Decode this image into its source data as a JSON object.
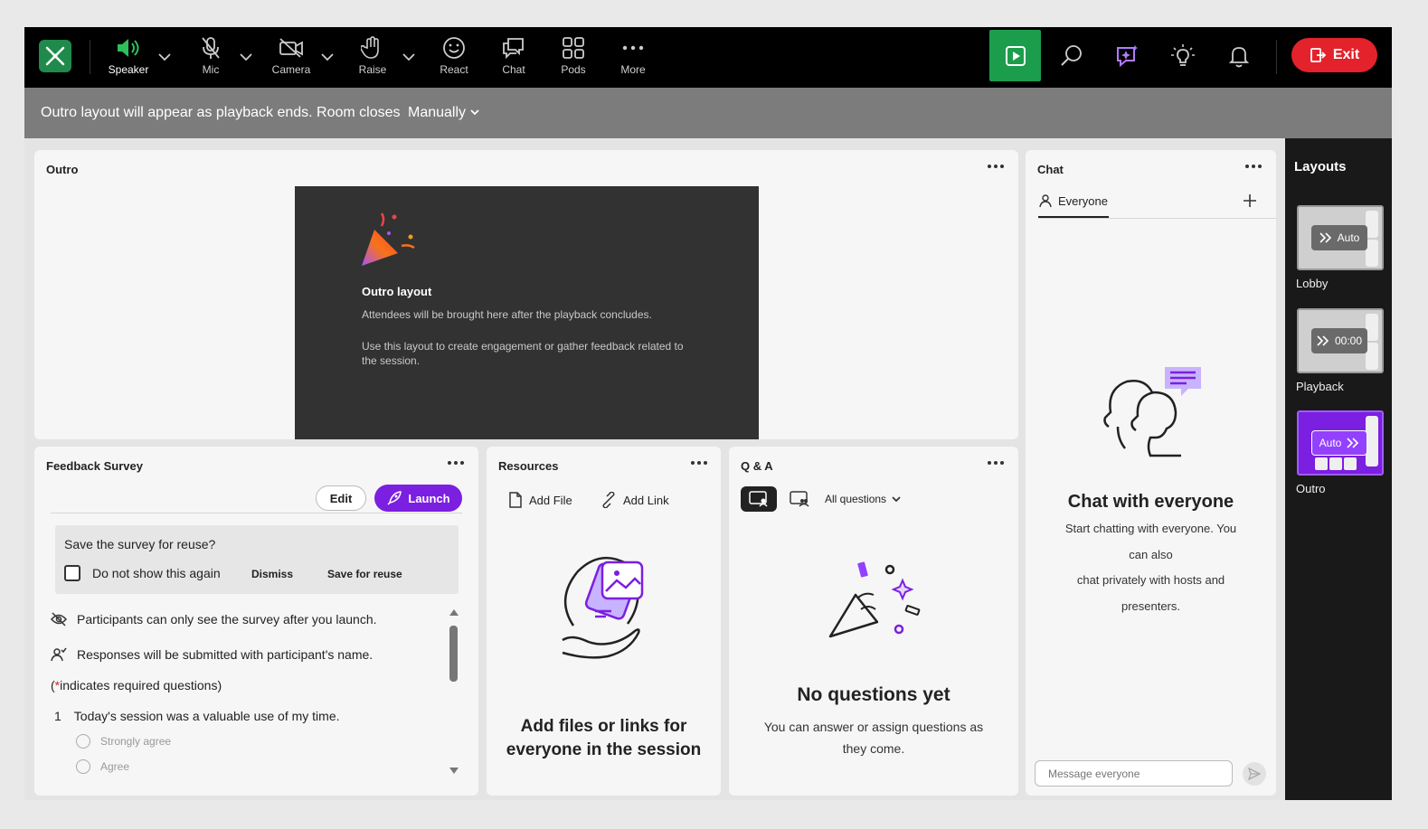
{
  "toolbar": {
    "items": [
      {
        "label": "Speaker",
        "icon": "speaker-icon"
      },
      {
        "label": "Mic",
        "icon": "mic-off-icon"
      },
      {
        "label": "Camera",
        "icon": "camera-off-icon"
      },
      {
        "label": "Raise",
        "icon": "hand-icon"
      },
      {
        "label": "React",
        "icon": "smiley-icon"
      },
      {
        "label": "Chat",
        "icon": "chat-icon"
      },
      {
        "label": "Pods",
        "icon": "pods-grid-icon"
      },
      {
        "label": "More",
        "icon": "more-dots-icon"
      }
    ],
    "exit_label": "Exit",
    "accent": "#1c9d4b",
    "exit_color": "#e3222b"
  },
  "banner": {
    "text": "Outro layout will appear as playback ends. Room closes",
    "mode": "Manually"
  },
  "outro": {
    "title": "Outro",
    "heading": "Outro layout",
    "line1": "Attendees will be brought here after the playback concludes.",
    "line2": "Use this layout to create engagement or gather feedback related to the session."
  },
  "survey": {
    "title": "Feedback Survey",
    "edit_label": "Edit",
    "launch_label": "Launch",
    "save_question": "Save the survey for reuse?",
    "checkbox_label": "Do not show this again",
    "dismiss_label": "Dismiss",
    "save_label": "Save for reuse",
    "note1": "Participants can only see the survey after you launch.",
    "note2": "Responses will be submitted with participant's name.",
    "required_prefix": "(",
    "required_star": "*",
    "required_text": " indicates required questions)",
    "question_number": "1",
    "question_text": "Today's session was a valuable use of my time.",
    "options": [
      "Strongly agree",
      "Agree"
    ],
    "accent": "#7b1fe0"
  },
  "resources": {
    "title": "Resources",
    "add_file": "Add File",
    "add_link": "Add Link",
    "empty_line1": "Add files or links for",
    "empty_line2": "everyone in the session"
  },
  "qa": {
    "title": "Q & A",
    "filter": "All questions",
    "empty_title": "No questions yet",
    "empty_line1": "You can answer or assign questions as",
    "empty_line2": "they come."
  },
  "chat": {
    "title": "Chat",
    "tab": "Everyone",
    "empty_title": "Chat with everyone",
    "empty_lines": [
      "Start chatting with everyone. You",
      "can also",
      "chat privately with hosts and",
      "presenters."
    ],
    "input_placeholder": "Message everyone"
  },
  "layouts": {
    "title": "Layouts",
    "items": [
      {
        "name": "Lobby",
        "pill": "Auto",
        "selected": false
      },
      {
        "name": "Playback",
        "pill": "00:00",
        "selected": false
      },
      {
        "name": "Outro",
        "pill": "Auto",
        "selected": true
      }
    ]
  }
}
